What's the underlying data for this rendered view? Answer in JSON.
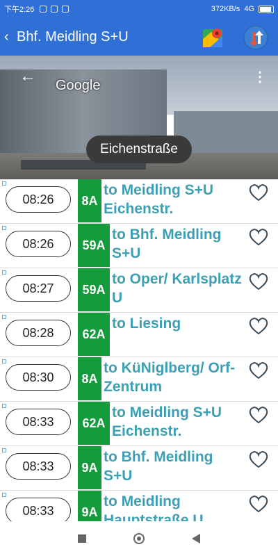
{
  "status": {
    "time": "下午2:26",
    "speed": "372KB/s",
    "network": "4G"
  },
  "app": {
    "title": "Bhf. Meidling S+U"
  },
  "street_view": {
    "provider": "Google",
    "location_label": "Eichenstraße"
  },
  "colors": {
    "primary": "#2f6fd6",
    "line_badge": "#149b3c",
    "destination_text": "#3c9fb3"
  },
  "departures": [
    {
      "time": "08:26",
      "line": "8A",
      "destination": "to Meidling S+U Eichenstr."
    },
    {
      "time": "08:26",
      "line": "59A",
      "destination": "to Bhf. Meidling S+U"
    },
    {
      "time": "08:27",
      "line": "59A",
      "destination": "to Oper/ Karlsplatz U"
    },
    {
      "time": "08:28",
      "line": "62A",
      "destination": "to Liesing"
    },
    {
      "time": "08:30",
      "line": "8A",
      "destination": "to KüNiglberg/ Orf-Zentrum"
    },
    {
      "time": "08:33",
      "line": "62A",
      "destination": "to Meidling S+U Eichenstr."
    },
    {
      "time": "08:33",
      "line": "9A",
      "destination": "to Bhf. Meidling S+U"
    },
    {
      "time": "08:33",
      "line": "9A",
      "destination": "to Meidling Hauptstraße U"
    }
  ]
}
